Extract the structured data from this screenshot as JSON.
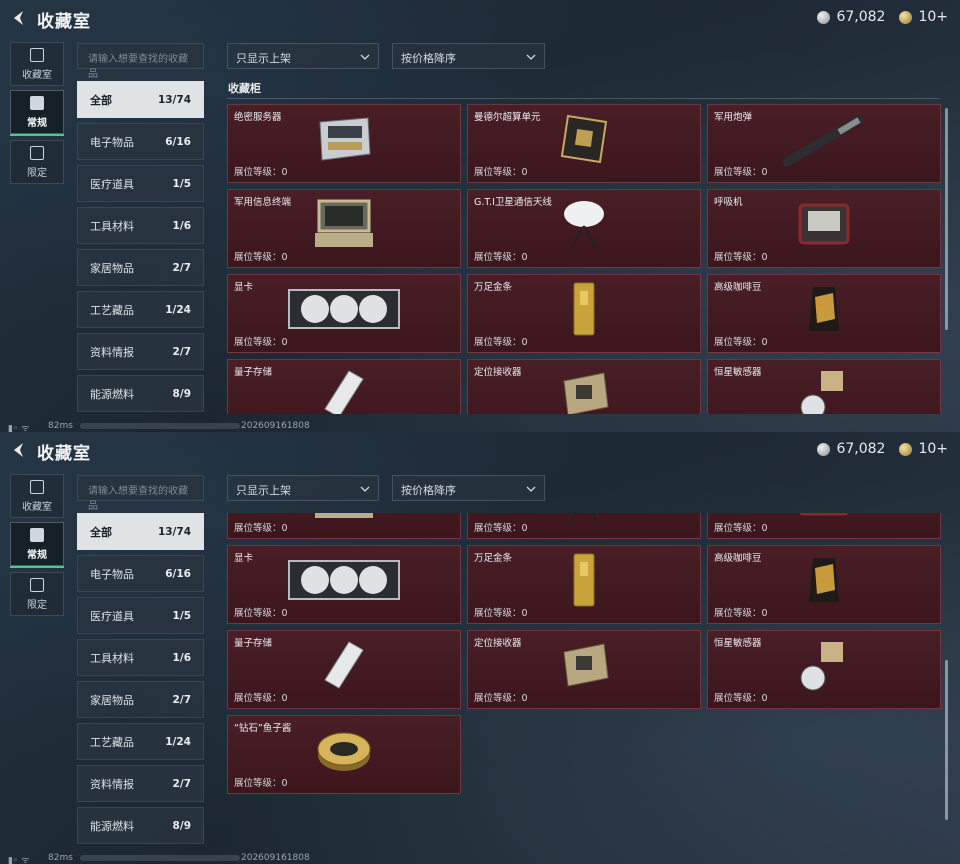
{
  "header": {
    "title": "收藏室"
  },
  "currency": {
    "silver": "67,082",
    "gold": "10+"
  },
  "left_nav": [
    {
      "label": "收藏室",
      "icon": "collection-room-icon"
    },
    {
      "label": "常规",
      "icon": "regular-icon",
      "active": true
    },
    {
      "label": "限定",
      "icon": "limited-icon"
    }
  ],
  "search": {
    "placeholder": "请输入想要查找的收藏品"
  },
  "filters": {
    "shelf": "只显示上架",
    "sort": "按价格降序"
  },
  "categories": [
    {
      "label": "全部",
      "count": "13/74",
      "active": true
    },
    {
      "label": "电子物品",
      "count": "6/16"
    },
    {
      "label": "医疗道具",
      "count": "1/5"
    },
    {
      "label": "工具材料",
      "count": "1/6"
    },
    {
      "label": "家居物品",
      "count": "2/7"
    },
    {
      "label": "工艺藏品",
      "count": "1/24"
    },
    {
      "label": "资料情报",
      "count": "2/7"
    },
    {
      "label": "能源燃料",
      "count": "8/9"
    }
  ],
  "cabinet": {
    "label": "收藏柜"
  },
  "level_text": "展位等级：0",
  "items": [
    {
      "name": "绝密服务器"
    },
    {
      "name": "曼德尔超算单元"
    },
    {
      "name": "军用炮弹"
    },
    {
      "name": "军用信息终端"
    },
    {
      "name": "G.T.I卫星通信天线"
    },
    {
      "name": "呼吸机"
    },
    {
      "name": "显卡"
    },
    {
      "name": "万足金条"
    },
    {
      "name": "高级咖啡豆"
    },
    {
      "name": "量子存储"
    },
    {
      "name": "定位接收器"
    },
    {
      "name": "恒星敏感器"
    },
    {
      "name": "“钻石”鱼子酱"
    }
  ],
  "status": {
    "latency": "82ms",
    "serial": "202609161808"
  },
  "colors": {
    "card_bg": "#451b22",
    "accent": "#4ec986",
    "active_tab": "#dfe3e6"
  }
}
